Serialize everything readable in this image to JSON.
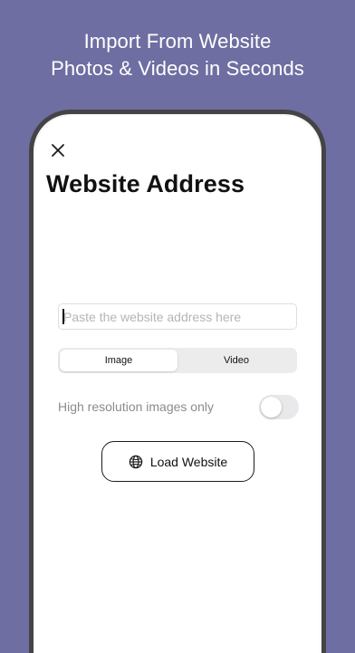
{
  "promo": {
    "line1": "Import From Website",
    "line2": "Photos & Videos in Seconds"
  },
  "screen": {
    "title": "Website Address",
    "close_icon": "close-icon",
    "url_input": {
      "value": "",
      "placeholder": "Paste the website address here"
    },
    "media_type": {
      "options": [
        "Image",
        "Video"
      ],
      "selected": "Image"
    },
    "high_res_toggle": {
      "label": "High resolution images only",
      "on": false
    },
    "load_button": {
      "label": "Load Website",
      "icon": "globe-icon"
    }
  },
  "colors": {
    "background": "#6e6ea2",
    "device_frame": "#444446",
    "text_primary": "#111111",
    "text_secondary": "#8b8b90"
  }
}
